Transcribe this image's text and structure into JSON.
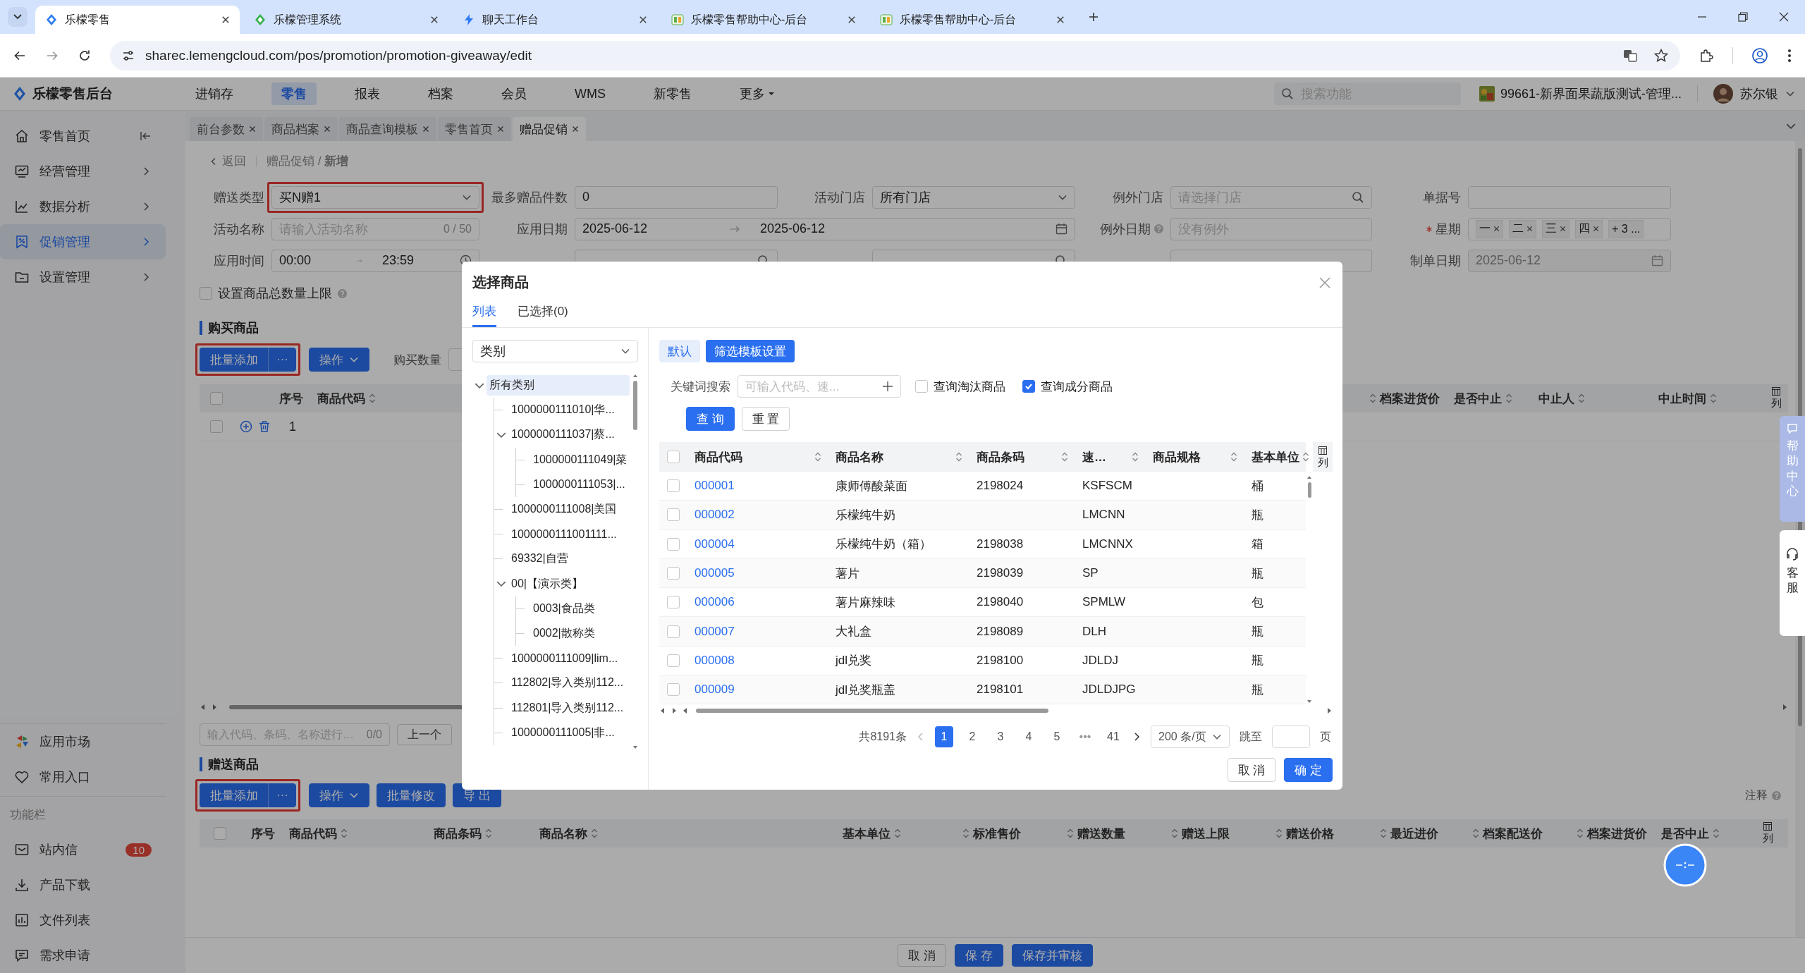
{
  "browser": {
    "tabs": [
      {
        "title": "乐檬零售",
        "selected": true
      },
      {
        "title": "乐檬管理系统",
        "selected": false
      },
      {
        "title": "聊天工作台",
        "selected": false
      },
      {
        "title": "乐檬零售帮助中心-后台",
        "selected": false
      },
      {
        "title": "乐檬零售帮助中心-后台",
        "selected": false
      }
    ],
    "url": "sharec.lemengcloud.com/pos/promotion/promotion-giveaway/edit"
  },
  "header": {
    "logo": "乐檬零售后台",
    "nav": [
      {
        "label": "进销存",
        "selected": false
      },
      {
        "label": "零售",
        "selected": true
      },
      {
        "label": "报表",
        "selected": false
      },
      {
        "label": "档案",
        "selected": false
      },
      {
        "label": "会员",
        "selected": false
      },
      {
        "label": "WMS",
        "selected": false
      },
      {
        "label": "新零售",
        "selected": false
      },
      {
        "label": "更多",
        "selected": false,
        "has_menu": true
      }
    ],
    "search": {
      "placeholder": "搜索功能"
    },
    "store": "99661-新界面果蔬版测试-管理...",
    "user": "苏尔银"
  },
  "sidebar": {
    "items": [
      {
        "label": "零售首页",
        "selected": false
      },
      {
        "label": "经营管理",
        "selected": false
      },
      {
        "label": "数据分析",
        "selected": false
      },
      {
        "label": "促销管理",
        "selected": true
      },
      {
        "label": "设置管理",
        "selected": false
      }
    ],
    "footer_items": [
      {
        "label": "应用市场"
      },
      {
        "label": "常用入口"
      }
    ],
    "section": "功能栏",
    "tools": [
      {
        "label": "站内信",
        "badge": "10"
      },
      {
        "label": "产品下载"
      },
      {
        "label": "文件列表"
      },
      {
        "label": "需求申请"
      }
    ]
  },
  "page_tabs": [
    {
      "label": "前台参数",
      "selected": false
    },
    {
      "label": "商品档案",
      "selected": false
    },
    {
      "label": "商品查询模板",
      "selected": false
    },
    {
      "label": "零售首页",
      "selected": false
    },
    {
      "label": "赠品促销",
      "selected": true
    }
  ],
  "breadcrumb": {
    "back": "返回",
    "path": "赠品促销 / **新增**"
  },
  "form": {
    "rows": [
      [
        {
          "kind": "select",
          "label": "赠送类型",
          "value": "买N赠1",
          "highlighted": true
        },
        {
          "kind": "text",
          "label": "最多赠品件数",
          "value": "0"
        },
        {
          "kind": "select",
          "label": "活动门店",
          "value": "所有门店"
        },
        {
          "kind": "search",
          "label": "例外门店",
          "placeholder": "请选择门店"
        },
        {
          "kind": "text",
          "label": "单据号"
        }
      ],
      [
        {
          "kind": "text",
          "label": "活动名称",
          "placeholder": "请输入活动名称",
          "counter": "0 / 50"
        },
        {
          "kind": "date_range",
          "label": "应用日期",
          "start": "2025-06-12",
          "end": "2025-06-12"
        },
        "",
        {
          "kind": "text",
          "label": "例外日期",
          "help": true,
          "placeholder": "没有例外"
        },
        {
          "kind": "tags",
          "label": "星期",
          "required": true,
          "tags": [
            "一",
            "二",
            "三",
            "四"
          ],
          "more": "+ 3 ..."
        }
      ],
      [
        {
          "kind": "time_range",
          "label": "应用时间",
          "start": "00:00",
          "end": "23:59"
        },
        {
          "kind": "search"
        },
        {
          "kind": "search"
        },
        {
          "kind": "text"
        },
        {
          "kind": "date",
          "label": "制单日期",
          "value": "2025-06-12",
          "disabled": true
        }
      ]
    ],
    "limit": {
      "label": "设置商品总数量上限",
      "checked": false
    }
  },
  "purchase": {
    "title": "购买商品",
    "toolbar": [
      {
        "kind": "split",
        "label": "批量添加",
        "more": "···",
        "highlighted": true
      },
      {
        "kind": "menu",
        "label": "操作"
      },
      {
        "kind": "field",
        "label": "购买数量"
      }
    ],
    "all_checked": false,
    "columns_left": [
      {
        "label": "序号"
      },
      {
        "label": "商品代码",
        "sortable": true
      }
    ],
    "columns_right": [
      {
        "label": "档案进货价",
        "sortable": true
      },
      {
        "label": "是否中止",
        "sortable": true
      },
      {
        "label": "中止人",
        "sortable": true
      },
      {
        "label": "中止时间",
        "sortable": true
      }
    ],
    "column_settings": "列",
    "rows": [
      {
        "checked": false,
        "index": "1"
      }
    ],
    "finder": {
      "placeholder": "输入代码、条码、名称进行…",
      "count": "0/0",
      "prev": "上一个"
    }
  },
  "gift": {
    "title": "赠送商品",
    "toolbar": [
      {
        "kind": "split",
        "label": "批量添加",
        "more": "···",
        "highlighted": true
      },
      {
        "kind": "menu",
        "label": "操作"
      },
      {
        "kind": "button",
        "label": "批量修改"
      },
      {
        "kind": "button",
        "label": "导 出"
      }
    ],
    "note": "注释",
    "all_checked": false,
    "columns": [
      {
        "label": "序号"
      },
      {
        "label": "商品代码",
        "sortable": true
      },
      {
        "label": "商品条码",
        "sortable": true
      },
      {
        "label": "商品名称",
        "sortable": true
      },
      {
        "label": "基本单位",
        "sortable": true
      },
      {
        "label": "标准售价",
        "sortable": true
      },
      {
        "label": "赠送数量",
        "sortable": true
      },
      {
        "label": "赠送上限",
        "sortable": true
      },
      {
        "label": "赠送价格",
        "sortable": true
      },
      {
        "label": "最近进价",
        "sortable": true
      },
      {
        "label": "档案配送价",
        "sortable": true
      },
      {
        "label": "档案进货价",
        "sortable": true
      },
      {
        "label": "是否中止",
        "sortable": true
      }
    ],
    "column_settings": "列"
  },
  "footer": [
    {
      "label": "取 消",
      "kind": "default"
    },
    {
      "label": "保 存",
      "kind": "primary"
    },
    {
      "label": "保存并审核",
      "kind": "primary"
    }
  ],
  "help": {
    "label": "帮助中心",
    "service": "客服"
  },
  "modal": {
    "title": "选择商品",
    "tabs": [
      {
        "label": "列表",
        "selected": true
      },
      {
        "label": "已选择(0)",
        "selected": false
      }
    ],
    "category": "类别",
    "tree": [
      {
        "label": "所有类别",
        "selected": true,
        "expanded": true,
        "children": [
          {
            "label": "1000000111010|华...",
            "selected": false
          },
          {
            "label": "1000000111037|蔡...",
            "selected": false,
            "expanded": true,
            "children": [
              {
                "label": "1000000111049|菜",
                "selected": false
              },
              {
                "label": "1000000111053|...",
                "selected": false
              }
            ]
          },
          {
            "label": "1000000111008|美国",
            "selected": false
          },
          {
            "label": "1000000111001111...",
            "selected": false
          },
          {
            "label": "69332|自营",
            "selected": false
          },
          {
            "label": "00|【演示类】",
            "selected": false,
            "expanded": true,
            "children": [
              {
                "label": "0003|食品类",
                "selected": false
              },
              {
                "label": "0002|散称类",
                "selected": false
              }
            ]
          },
          {
            "label": "1000000111009|lim...",
            "selected": false
          },
          {
            "label": "112802|导入类别112...",
            "selected": false
          },
          {
            "label": "112801|导入类别112...",
            "selected": false
          },
          {
            "label": "1000000111005|非...",
            "selected": false
          }
        ]
      }
    ],
    "filter_buttons": [
      {
        "label": "默认",
        "selected": false
      },
      {
        "label": "筛选模板设置",
        "selected": true
      }
    ],
    "keyword": {
      "label": "关键词搜索",
      "placeholder": "可输入代码、速..."
    },
    "options": [
      {
        "label": "查询淘汰商品",
        "checked": false
      },
      {
        "label": "查询成分商品",
        "checked": true
      }
    ],
    "actions": [
      {
        "label": "查 询",
        "kind": "primary"
      },
      {
        "label": "重 置",
        "kind": "default"
      }
    ],
    "table": {
      "all_checked": false,
      "columns": [
        "商品代码",
        "商品名称",
        "商品条码",
        "速…",
        "商品规格",
        "基本单位"
      ],
      "column_settings": "列",
      "rows": [
        {
          "checked": false,
          "code": "000001",
          "name": "康师傅酸菜面",
          "barcode": "2198024",
          "short_code": "KSFSCM",
          "unit": "桶"
        },
        {
          "checked": false,
          "code": "000002",
          "name": "乐檬纯牛奶",
          "short_code": "LMCNN",
          "unit": "瓶"
        },
        {
          "checked": false,
          "code": "000004",
          "name": "乐檬纯牛奶（箱）",
          "barcode": "2198038",
          "short_code": "LMCNNX",
          "unit": "箱"
        },
        {
          "checked": false,
          "code": "000005",
          "name": "薯片",
          "barcode": "2198039",
          "short_code": "SP",
          "unit": "瓶"
        },
        {
          "checked": false,
          "code": "000006",
          "name": "薯片麻辣味",
          "barcode": "2198040",
          "short_code": "SPMLW",
          "unit": "包"
        },
        {
          "checked": false,
          "code": "000007",
          "name": "大礼盒",
          "barcode": "2198089",
          "short_code": "DLH",
          "unit": "瓶"
        },
        {
          "checked": false,
          "code": "000008",
          "name": "jdl兑奖",
          "barcode": "2198100",
          "short_code": "JDLDJ",
          "unit": "瓶"
        },
        {
          "checked": false,
          "code": "000009",
          "name": "jdl兑奖瓶盖",
          "barcode": "2198101",
          "short_code": "JDLDJPG",
          "unit": "瓶"
        }
      ]
    },
    "pagination": {
      "total": "共8191条",
      "pages": [
        {
          "label": "1",
          "kind": "page",
          "selected": true
        },
        {
          "label": "2",
          "kind": "page",
          "selected": false
        },
        {
          "label": "3",
          "kind": "page",
          "selected": false
        },
        {
          "label": "4",
          "kind": "page",
          "selected": false
        },
        {
          "label": "5",
          "kind": "page",
          "selected": false
        },
        {
          "label": "•••",
          "kind": "ellipsis",
          "selected": false
        },
        {
          "label": "41",
          "kind": "page",
          "selected": false
        }
      ],
      "page_size": "200 条/页",
      "jump": "跳至",
      "page_unit": "页"
    },
    "footer": [
      {
        "label": "取 消",
        "kind": "default"
      },
      {
        "label": "确 定",
        "kind": "primary"
      }
    ]
  }
}
